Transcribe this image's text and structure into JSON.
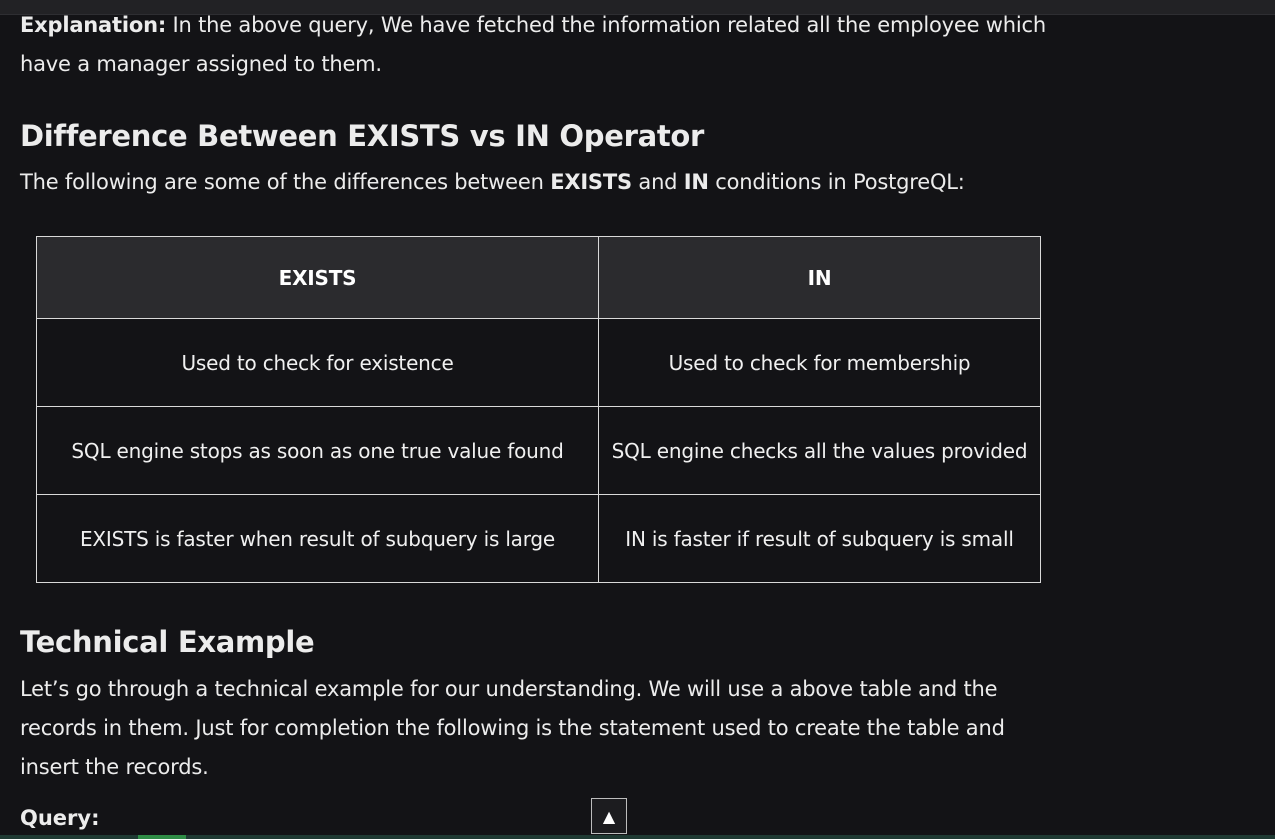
{
  "intro": {
    "label": "Explanation:",
    "text": " In the above query, We have fetched the information related all the employee which have a manager assigned to them."
  },
  "difference": {
    "heading": "Difference Between EXISTS vs IN Operator",
    "text_prefix": "The following are some of the differences between ",
    "bold1": "EXISTS",
    "text_mid": " and ",
    "bold2": "IN",
    "text_suffix": " conditions in PostgreQL:"
  },
  "table": {
    "headers": [
      "EXISTS",
      "IN"
    ],
    "rows": [
      [
        "Used to check for existence",
        "Used to check for membership"
      ],
      [
        "SQL engine stops as soon as one true value found",
        "SQL engine checks all the values provided"
      ],
      [
        "EXISTS is faster when result of subquery is large",
        "IN is faster if result of subquery is small"
      ]
    ]
  },
  "technical": {
    "heading": "Technical Example",
    "text": "Let’s go through a technical example for our understanding. We will use a above table and the records in them. Just for completion the following is the statement used to create the table and insert the records."
  },
  "query_label": "Query:",
  "scroll_top_glyph": "▲",
  "icons": {
    "scroll_top": "arrow-up-icon"
  },
  "colors": {
    "background": "#131316",
    "table_header": "#2b2b2e",
    "accent": "#2f8d46"
  }
}
